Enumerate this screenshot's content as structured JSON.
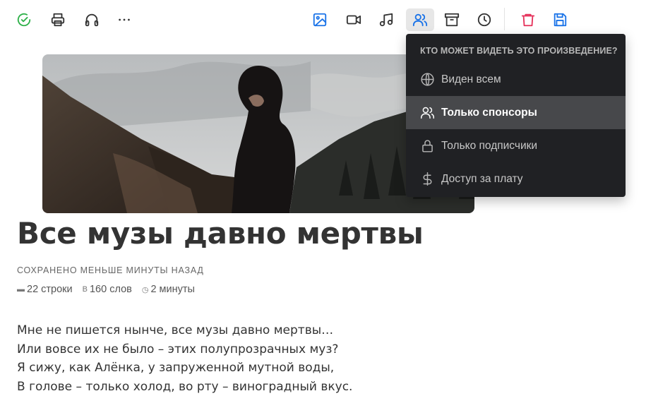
{
  "toolbar": {
    "buttons": [
      {
        "icon": "check-circle-icon",
        "color": "#2fb14a"
      },
      {
        "icon": "printer-icon",
        "color": "#333333"
      },
      {
        "icon": "headphones-icon",
        "color": "#333333"
      },
      {
        "icon": "more-icon",
        "color": "#333333"
      },
      {
        "icon": "image-icon",
        "color": "#1a73e8"
      },
      {
        "icon": "video-icon",
        "color": "#333333"
      },
      {
        "icon": "music-icon",
        "color": "#333333"
      },
      {
        "icon": "users-icon",
        "color": "#1a73e8",
        "active": true
      },
      {
        "icon": "archive-icon",
        "color": "#333333"
      },
      {
        "icon": "clock-icon",
        "color": "#333333"
      },
      {
        "icon": "trash-icon",
        "color": "#e5315a"
      },
      {
        "icon": "save-icon",
        "color": "#1a73e8"
      }
    ]
  },
  "post": {
    "title": "Все музы давно мертвы",
    "saved": "СОХРАНЕНО МЕНЬШЕ МИНУТЫ НАЗАД",
    "stats": {
      "lines": "22 строки",
      "words": "160 слов",
      "time": "2 минуты"
    },
    "poem_lines": [
      "Мне не пишется нынче, все музы давно мертвы…",
      "Или вовсе их не было – этих полупрозрачных муз?",
      "Я сижу, как Алёнка, у запруженной мутной воды,",
      "В голове – только холод, во рту – виноградный вкус."
    ]
  },
  "visibility_menu": {
    "header": "КТО МОЖЕТ ВИДЕТЬ ЭТО ПРОИЗВЕДЕНИЕ?",
    "options": [
      {
        "icon": "globe-icon",
        "label": "Виден всем"
      },
      {
        "icon": "users-icon",
        "label": "Только спонсоры",
        "selected": true
      },
      {
        "icon": "lock-icon",
        "label": "Только подписчики"
      },
      {
        "icon": "dollar-icon",
        "label": "Доступ за плату"
      }
    ],
    "background": "#202124",
    "selected_background": "#47484b"
  }
}
